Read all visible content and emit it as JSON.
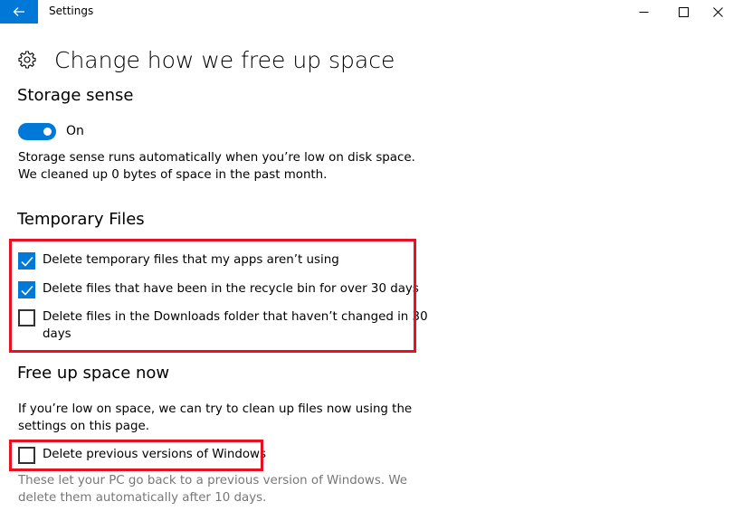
{
  "window": {
    "title": "Settings",
    "back_icon": "back-arrow-icon",
    "controls": [
      "minimize-icon",
      "maximize-icon",
      "close-icon"
    ]
  },
  "page": {
    "title": "Change how we free up space",
    "icon": "gear-icon"
  },
  "storage_sense": {
    "heading": "Storage sense",
    "toggle_state": "On",
    "toggle_on": true,
    "description_lines": [
      "Storage sense runs automatically when you’re low on disk space.",
      "We cleaned up 0 bytes of space in the past month."
    ]
  },
  "temporary_files": {
    "heading": "Temporary Files",
    "options": [
      {
        "label_lines": [
          "Delete temporary files that my apps aren’t using"
        ],
        "checked": true
      },
      {
        "label_lines": [
          "Delete files that have been in the recycle bin for over 30 days"
        ],
        "checked": true
      },
      {
        "label_lines": [
          "Delete files in the Downloads folder that haven’t changed in 30",
          "days"
        ],
        "checked": false
      }
    ]
  },
  "free_up_now": {
    "heading": "Free up space now",
    "description_lines": [
      "If you’re low on space, we can try to clean up files now using the",
      "settings on this page."
    ],
    "option": {
      "label": "Delete previous versions of Windows",
      "checked": false
    },
    "note_lines": [
      "These let your PC go back to a previous version of Windows. We",
      "delete them automatically after 10 days."
    ]
  },
  "colors": {
    "accent": "#0078d7",
    "highlight": "#e81123",
    "muted_text": "#777777"
  }
}
